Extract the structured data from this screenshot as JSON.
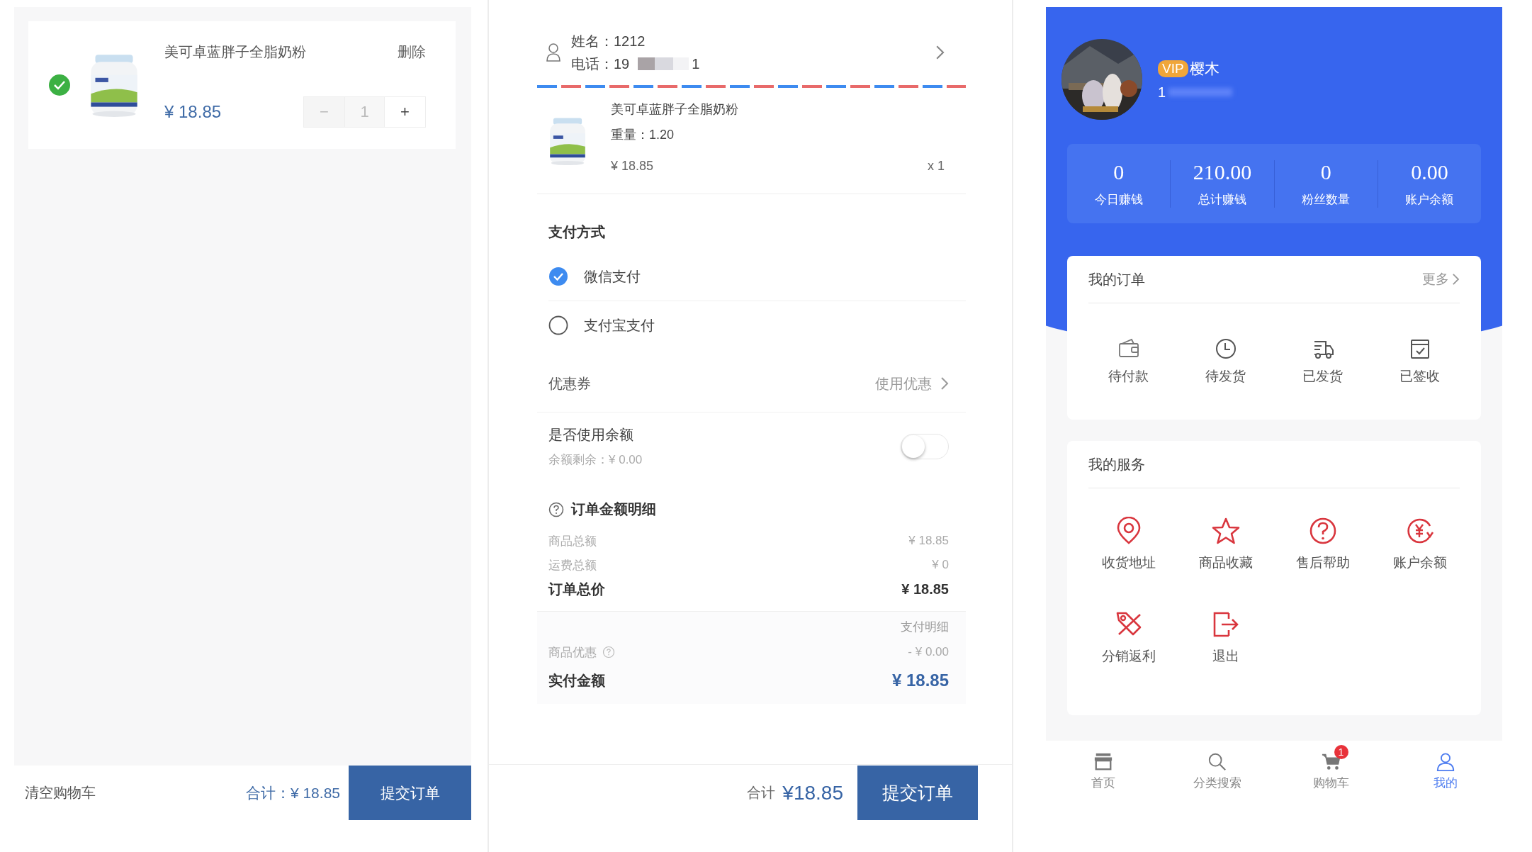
{
  "cart": {
    "items": [
      {
        "name": "美可卓蓝胖子全脂奶粉",
        "delete_label": "删除",
        "price": "¥ 18.85",
        "minus": "−",
        "quantity": "1",
        "plus": "+",
        "checked": true,
        "decrease_disabled": true
      }
    ],
    "footer": {
      "clear": "清空购物车",
      "total": "合计：¥ 18.85",
      "submit": "提交订单"
    }
  },
  "checkout": {
    "contact": {
      "name": "姓名：1212",
      "phone_prefix": "电话：19",
      "phone_suffix": "1"
    },
    "item": {
      "name": "美可卓蓝胖子全脂奶粉",
      "weight": "重量：1.20",
      "price": "¥ 18.85",
      "quantity": "x 1"
    },
    "payment": {
      "title": "支付方式",
      "options": [
        {
          "label": "微信支付",
          "selected": true
        },
        {
          "label": "支付宝支付",
          "selected": false
        }
      ]
    },
    "coupon": {
      "label": "优惠券",
      "action": "使用优惠"
    },
    "balance": {
      "label": "是否使用余额",
      "remaining": "余额剩余：¥ 0.00",
      "on": false
    },
    "details": {
      "title": "订单金额明细",
      "rows": [
        {
          "kind": "plain",
          "label": "商品总额",
          "value": "¥ 18.85"
        },
        {
          "kind": "plain",
          "label": "运费总额",
          "value": "¥ 0"
        },
        {
          "kind": "total",
          "label": "订单总价",
          "value": "¥ 18.85"
        }
      ]
    },
    "payment_details": {
      "title": "支付明细",
      "rows": [
        {
          "kind": "help",
          "label": "商品优惠",
          "value": "- ¥ 0.00"
        },
        {
          "kind": "paid",
          "label": "实付金额",
          "value": "¥ 18.85"
        }
      ]
    },
    "footer": {
      "total_label": "合计",
      "total": "¥18.85",
      "submit": "提交订单"
    }
  },
  "profile": {
    "vip": "VIP",
    "name": "樱木",
    "phone": "1",
    "stats": [
      {
        "value": "0",
        "label": "今日赚钱"
      },
      {
        "value": "210.00",
        "label": "总计赚钱"
      },
      {
        "value": "0",
        "label": "粉丝数量"
      },
      {
        "value": "0.00",
        "label": "账户余额"
      }
    ],
    "orders": {
      "title": "我的订单",
      "more": "更多",
      "items": [
        {
          "label": "待付款"
        },
        {
          "label": "待发货"
        },
        {
          "label": "已发货"
        },
        {
          "label": "已签收"
        }
      ]
    },
    "services": {
      "title": "我的服务",
      "items": [
        {
          "label": "收货地址"
        },
        {
          "label": "商品收藏"
        },
        {
          "label": "售后帮助"
        },
        {
          "label": "账户余额"
        },
        {
          "label": "分销返利"
        },
        {
          "label": "退出"
        }
      ]
    },
    "tabbar": [
      {
        "label": "首页",
        "selected": false
      },
      {
        "label": "分类搜索",
        "selected": false
      },
      {
        "label": "购物车",
        "selected": false,
        "badge": "1"
      },
      {
        "label": "我的",
        "selected": true
      }
    ]
  }
}
